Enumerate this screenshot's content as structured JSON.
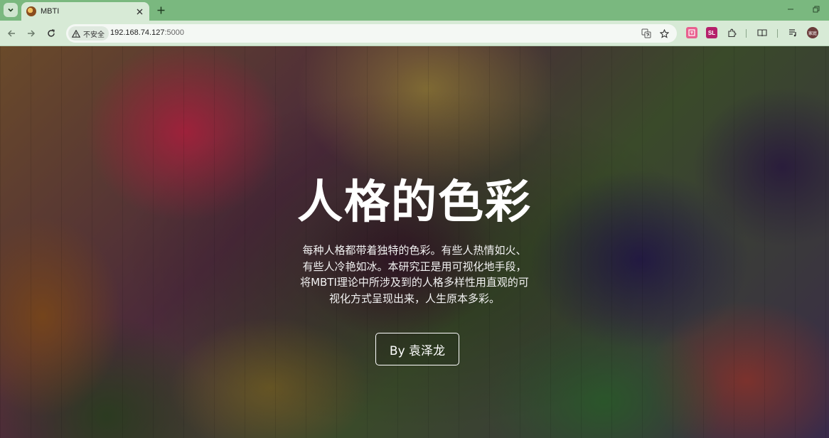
{
  "browser": {
    "tab": {
      "title": "MBTI"
    },
    "address": {
      "security_label": "不安全",
      "host": "192.168.74.127",
      "port": ":5000"
    },
    "avatar_text": "家庭"
  },
  "hero": {
    "title": "人格的色彩",
    "description_lines": [
      "每种人格都带着独特的色彩。有些人热情如火、",
      "有些人冷艳如冰。本研究正是用可视化地手段，",
      "将MBTI理论中所涉及到的人格多样性用直观的可",
      "视化方式呈现出来，人生原本多彩。"
    ],
    "author_button": "By 袁泽龙"
  }
}
